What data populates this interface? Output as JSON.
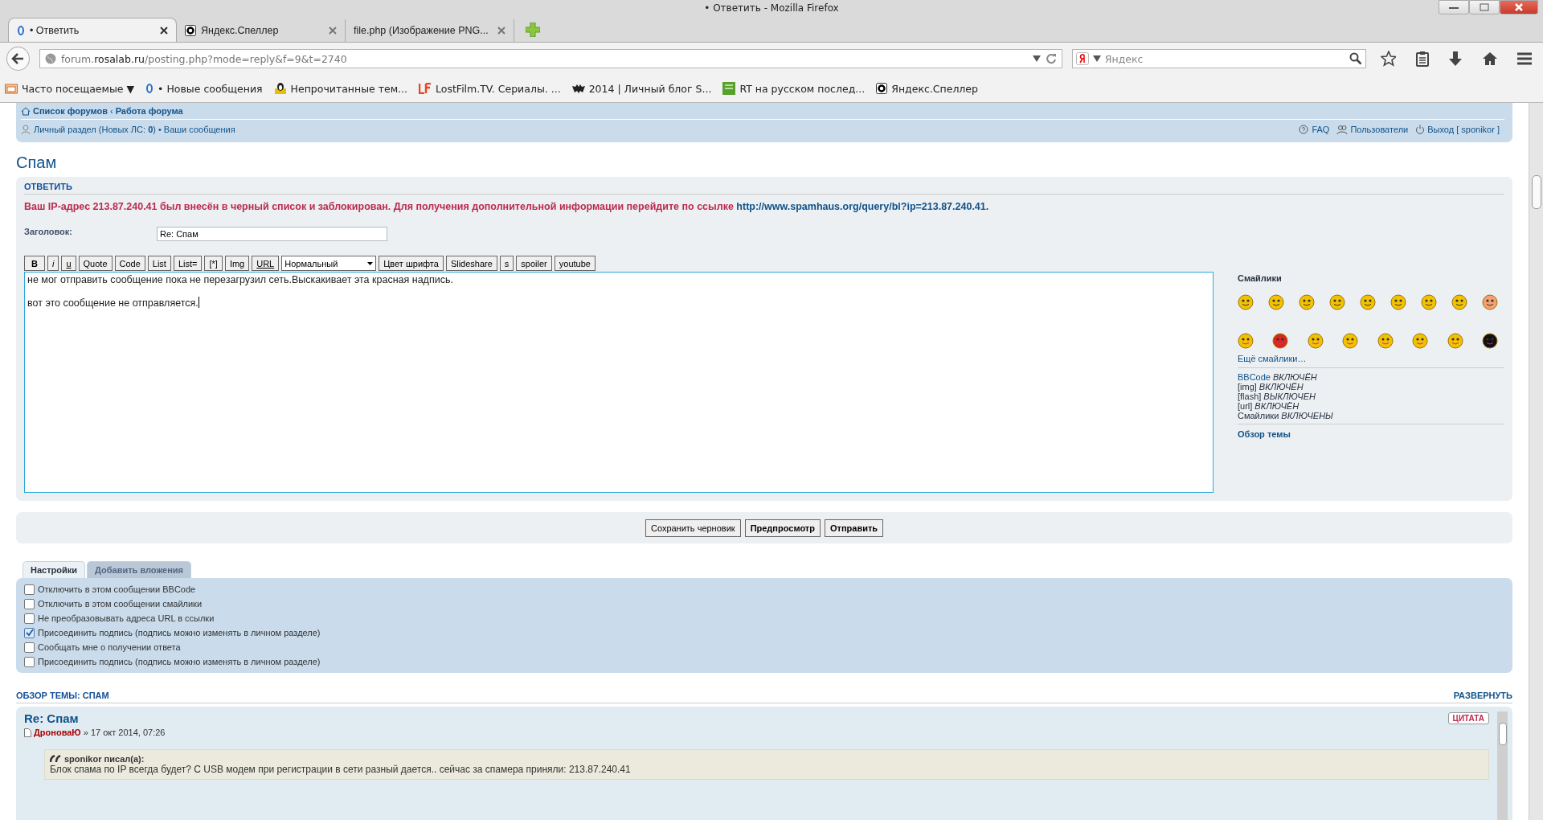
{
  "window": {
    "title": "• Ответить - Mozilla Firefox"
  },
  "tabs": [
    {
      "label": "• Ответить",
      "selected": true
    },
    {
      "label": "Яндекс.Спеллер",
      "selected": false
    },
    {
      "label": "file.php (Изображение PNG...",
      "selected": false
    }
  ],
  "address_bar": {
    "url_prefix": "forum.",
    "url_domain": "rosalab.ru",
    "url_path": "/posting.php?mode=reply&f=9&t=2740"
  },
  "search": {
    "placeholder": "Яндекс"
  },
  "bookmarks": [
    {
      "label": "Часто посещаемые ▼",
      "kind": "folder"
    },
    {
      "label": "• Новые сообщения",
      "kind": "forum"
    },
    {
      "label": "Непрочитанные тем...",
      "kind": "linux"
    },
    {
      "label": "LostFilm.TV. Сериалы. ...",
      "kind": "lf"
    },
    {
      "label": "2014 | Личный блог S...",
      "kind": "bat"
    },
    {
      "label": "RT на русском послед...",
      "kind": "rt"
    },
    {
      "label": "Яндекс.Спеллер",
      "kind": "speller"
    }
  ],
  "forum_nav": {
    "breadcrumbs": [
      "Список форумов",
      "Работа форума"
    ],
    "separator": "‹",
    "user_link": "Личный раздел (Новых ЛС: **0**)",
    "bullet": "•",
    "messages_link": "Ваши сообщения",
    "right_links": [
      {
        "label": "FAQ",
        "kind": "faq"
      },
      {
        "label": "Пользователи",
        "kind": "users"
      },
      {
        "label": "Выход [ sponikor ]",
        "kind": "logout"
      }
    ]
  },
  "topic_title": "Спам",
  "reply": {
    "heading": "ОТВЕТИТЬ",
    "error": "Ваш IP-адрес 213.87.240.41 был внесён в черный список и заблокирован. Для получения дополнительной информации перейдите по ссылке",
    "error_link": "http://www.spamhaus.org/query/bl?ip=213.87.240.41.",
    "subject_label": "Заголовок:",
    "subject_value": "Re: Спам",
    "toolbar": [
      {
        "label": "B",
        "kind": "bold"
      },
      {
        "label": "i",
        "kind": "italic"
      },
      {
        "label": "u",
        "kind": "underline"
      },
      {
        "label": "Quote",
        "kind": "button"
      },
      {
        "label": "Code",
        "kind": "button"
      },
      {
        "label": "List",
        "kind": "button"
      },
      {
        "label": "List=",
        "kind": "button"
      },
      {
        "label": "[*]",
        "kind": "button"
      },
      {
        "label": "Img",
        "kind": "button"
      },
      {
        "label": "URL",
        "kind": "underline"
      },
      {
        "label": "Нормальный",
        "kind": "select"
      },
      {
        "label": "Цвет шрифта",
        "kind": "button"
      },
      {
        "label": "Slideshare",
        "kind": "button"
      },
      {
        "label": "s",
        "kind": "button"
      },
      {
        "label": "spoiler",
        "kind": "button"
      },
      {
        "label": "youtube",
        "kind": "button"
      }
    ],
    "message": "не мог отправить сообщение пока не перезагрузил сеть.Выскакивает эта красная надпись.\n\nвот это сообщение не отправляется.",
    "smilies_title": "Смайлики",
    "more_smilies": "Ещё смайлики…",
    "features": [
      {
        "name": "BBCode",
        "state": "ВКЛЮЧЁН",
        "kind": "link"
      },
      {
        "name": "[img]",
        "state": "ВКЛЮЧЁН",
        "kind": "text"
      },
      {
        "name": "[flash]",
        "state": "ВЫКЛЮЧЕН",
        "kind": "text"
      },
      {
        "name": "[url]",
        "state": "ВКЛЮЧЁН",
        "kind": "text"
      },
      {
        "name": "Смайлики",
        "state": "ВКЛЮЧЕНЫ",
        "kind": "text"
      }
    ],
    "topic_review_link": "Обзор темы"
  },
  "buttons": [
    {
      "label": "Сохранить черновик",
      "kind": "normal"
    },
    {
      "label": "Предпросмотр",
      "kind": "bold"
    },
    {
      "label": "Отправить",
      "kind": "bold"
    }
  ],
  "option_tabs": [
    {
      "label": "Настройки",
      "selected": true
    },
    {
      "label": "Добавить вложения",
      "selected": false
    }
  ],
  "options": [
    {
      "label": "Отключить в этом сообщении BBCode",
      "checked": false
    },
    {
      "label": "Отключить в этом сообщении смайлики",
      "checked": false
    },
    {
      "label": "Не преобразовывать адреса URL в ссылки",
      "checked": false
    },
    {
      "label": "Присоединить подпись (подпись можно изменять в личном разделе)",
      "checked": true
    },
    {
      "label": "Сообщать мне о получении ответа",
      "checked": false
    },
    {
      "label": "Присоединить подпись (подпись можно изменять в личном разделе)",
      "checked": false
    }
  ],
  "review": {
    "heading": "ОБЗОР ТЕМЫ: СПАМ",
    "expand": "РАЗВЕРНУТЬ",
    "post": {
      "title": "Re: Спам",
      "author": "ДроноваЮ",
      "date": "» 17 окт 2014, 07:26",
      "quote_button": "ЦИТАТА",
      "quote_author": "sponikor писал(а):",
      "quote_text": "Блок спама по IP всегда будет? С USB модем при регистрации в сети разный дается.. сейчас за спамера приняли: 213.87.240.41"
    }
  }
}
